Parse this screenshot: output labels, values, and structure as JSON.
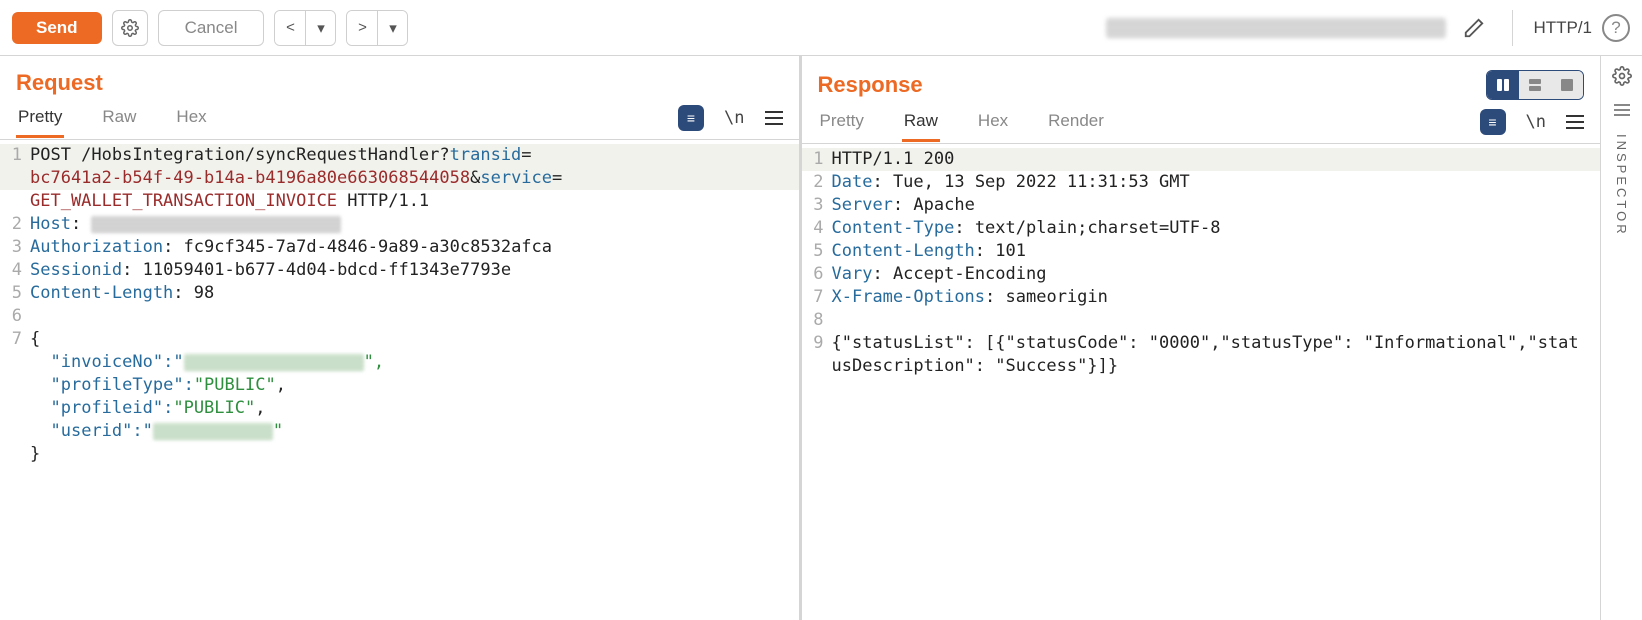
{
  "toolbar": {
    "send": "Send",
    "cancel": "Cancel",
    "protocol": "HTTP/1"
  },
  "panels": {
    "request": {
      "title": "Request",
      "tabs": [
        "Pretty",
        "Raw",
        "Hex"
      ],
      "active_tab": "Pretty",
      "lines": {
        "l1": {
          "pre": "POST /HobsIntegration/syncRequestHandler?",
          "k1": "transid",
          "eq": "="
        },
        "l1b": {
          "val": "bc7641a2-b54f-49-b14a-b4196a80e663068544058",
          "amp": "&",
          "k2": "service",
          "eq": "="
        },
        "l1c": {
          "val2": "GET_WALLET_TRANSACTION_INVOICE",
          "tail": " HTTP/1.1"
        },
        "l2": {
          "k": "Host",
          "sep": ": "
        },
        "l3": {
          "k": "Authorization",
          "sep": ": ",
          "v": "fc9cf345-7a7d-4846-9a89-a30c8532afca"
        },
        "l4": {
          "k": "Sessionid",
          "sep": ": ",
          "v": "11059401-b677-4d04-bdcd-ff1343e7793e"
        },
        "l5": {
          "k": "Content-Length",
          "sep": ": ",
          "v": "98"
        },
        "l7": "{",
        "l7a": {
          "pad": "  ",
          "q": "\"",
          "k": "invoiceNo",
          "mid": "\":\"",
          "end": "\","
        },
        "l7b": {
          "pad": "  ",
          "q": "\"",
          "k": "profileType",
          "mid": "\":",
          "v": "\"PUBLIC\"",
          "end": ","
        },
        "l7c": {
          "pad": "  ",
          "q": "\"",
          "k": "profileid",
          "mid": "\":",
          "v": "\"PUBLIC\"",
          "end": ","
        },
        "l7d": {
          "pad": "  ",
          "q": "\"",
          "k": "userid",
          "mid": "\":\"",
          "end": "\""
        },
        "l7e": "}"
      }
    },
    "response": {
      "title": "Response",
      "tabs": [
        "Pretty",
        "Raw",
        "Hex",
        "Render"
      ],
      "active_tab": "Raw",
      "lines": {
        "l1": "HTTP/1.1 200",
        "l2": {
          "k": "Date",
          "sep": ": ",
          "v": "Tue, 13 Sep 2022 11:31:53 GMT"
        },
        "l3": {
          "k": "Server",
          "sep": ": ",
          "v": "Apache"
        },
        "l4": {
          "k": "Content-Type",
          "sep": ": ",
          "v": "text/plain;charset=UTF-8"
        },
        "l5": {
          "k": "Content-Length",
          "sep": ": ",
          "v": "101"
        },
        "l6": {
          "k": "Vary",
          "sep": ": ",
          "v": "Accept-Encoding"
        },
        "l7": {
          "k": "X-Frame-Options",
          "sep": ": ",
          "v": "sameorigin"
        },
        "l9": "{\"statusList\": [{\"statusCode\": \"0000\",\"statusType\": \"Informational\",\"statusDescription\": \"Success\"}]}"
      }
    }
  },
  "rail": {
    "inspector": "INSPECTOR"
  },
  "icons": {
    "wrap": "\\n",
    "chip": "≡"
  }
}
